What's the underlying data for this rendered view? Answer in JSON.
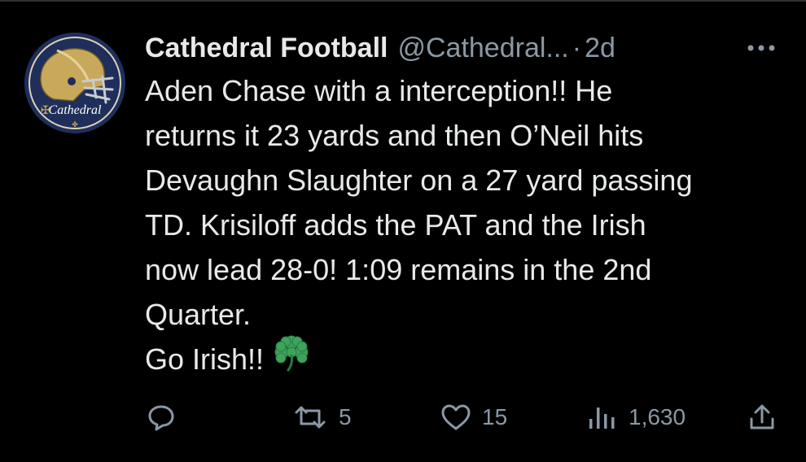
{
  "tweet": {
    "display_name": "Cathedral Football",
    "handle": "@Cathedral...",
    "separator": "·",
    "time": "2d",
    "avatar_text": "Cathedral",
    "lines": [
      "Aden Chase with a interception!!  He",
      "returns it 23 yards and then O’Neil hits",
      "Devaughn Slaughter on a 27 yard passing",
      "TD. Krisiloff adds the PAT and the Irish",
      "now lead 28-0! 1:09 remains in the 2nd",
      "Quarter.",
      "Go Irish!!"
    ],
    "emoji": "shamrock"
  },
  "actions": {
    "reply": {
      "icon": "reply-icon",
      "count": ""
    },
    "retweet": {
      "icon": "retweet-icon",
      "count": "5"
    },
    "like": {
      "icon": "heart-icon",
      "count": "15"
    },
    "views": {
      "icon": "views-icon",
      "count": "1,630"
    },
    "share": {
      "icon": "share-icon",
      "count": ""
    }
  },
  "colors": {
    "background": "#000000",
    "text": "#e7e9ea",
    "muted": "#8b98a5",
    "avatar_bg": "#1f2e5a",
    "helmet_gold": "#c8a85a",
    "shamrock": "#3da35d"
  }
}
